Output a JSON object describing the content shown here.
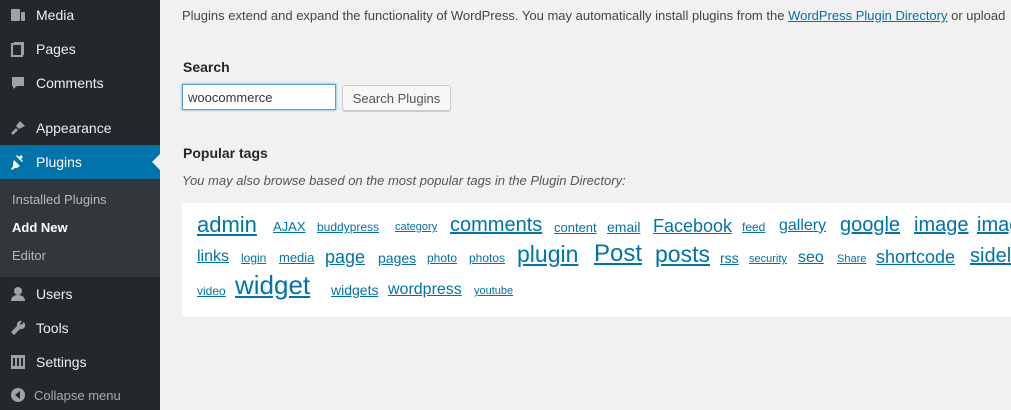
{
  "sidebar": {
    "items": [
      {
        "label": "Media",
        "icon": "media-icon"
      },
      {
        "label": "Pages",
        "icon": "pages-icon"
      },
      {
        "label": "Comments",
        "icon": "comments-icon"
      },
      {
        "label": "Appearance",
        "icon": "appearance-icon"
      },
      {
        "label": "Plugins",
        "icon": "plugins-icon"
      },
      {
        "label": "Users",
        "icon": "users-icon"
      },
      {
        "label": "Tools",
        "icon": "tools-icon"
      },
      {
        "label": "Settings",
        "icon": "settings-icon"
      }
    ],
    "submenu": [
      "Installed Plugins",
      "Add New",
      "Editor"
    ],
    "collapse_label": "Collapse menu",
    "active_color": "#0073aa"
  },
  "main": {
    "intro_text": "Plugins extend and expand the functionality of WordPress. You may automatically install plugins from the ",
    "intro_link": "WordPress Plugin Directory",
    "intro_tail": " or upload",
    "search_heading": "Search",
    "search_value": "woocommerce",
    "search_button": "Search Plugins",
    "popular_heading": "Popular tags",
    "popular_desc": "You may also browse based on the most popular tags in the Plugin Directory:",
    "tags": [
      "admin",
      "AJAX",
      "buddypress",
      "category",
      "comments",
      "content",
      "email",
      "Facebook",
      "feed",
      "gallery",
      "google",
      "image",
      "imag",
      "links",
      "login",
      "media",
      "page",
      "pages",
      "photo",
      "photos",
      "plugin",
      "Post",
      "posts",
      "rss",
      "security",
      "seo",
      "Share",
      "shortcode",
      "sidel",
      "video",
      "widget",
      "widgets",
      "wordpress",
      "youtube"
    ]
  }
}
